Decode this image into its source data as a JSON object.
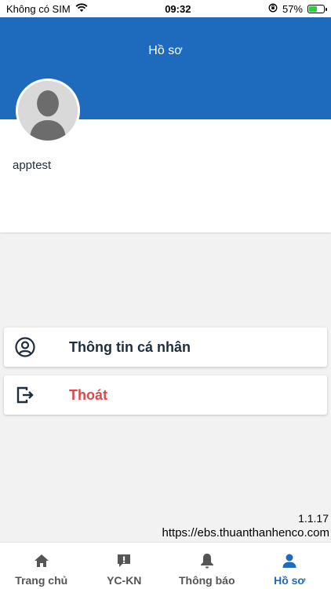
{
  "status_bar": {
    "carrier": "Không có SIM",
    "time": "09:32",
    "battery": "57%",
    "battery_level": 0.57
  },
  "header": {
    "title": "Hồ sơ"
  },
  "profile": {
    "username": "apptest"
  },
  "menu": {
    "personal_info": "Thông tin cá nhân",
    "logout": "Thoát"
  },
  "footer": {
    "version": "1.1.17",
    "url": "https://ebs.thuanthanhenco.com"
  },
  "tabs": [
    {
      "label": "Trang chủ",
      "icon": "home-icon"
    },
    {
      "label": "YC-KN",
      "icon": "alert-message-icon"
    },
    {
      "label": "Thông báo",
      "icon": "bell-icon"
    },
    {
      "label": "Hồ sơ",
      "icon": "person-icon"
    }
  ],
  "colors": {
    "header_blue": "#1e6bbd",
    "logout_red": "#d74b4b",
    "active_tab": "#1e6bbd"
  }
}
